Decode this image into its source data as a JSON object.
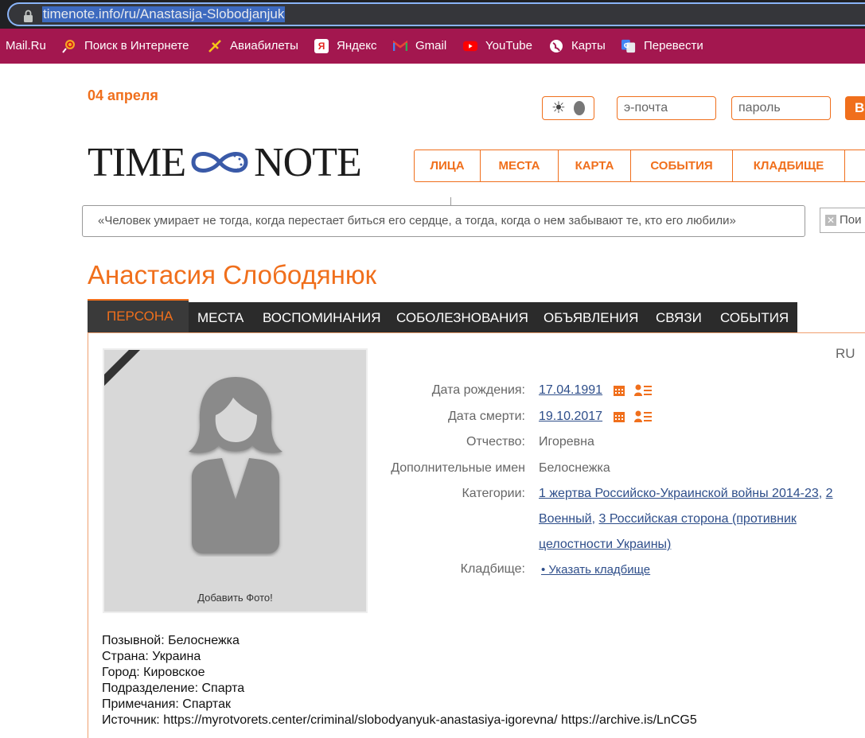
{
  "browser": {
    "url": "timenote.info/ru/Anastasija-Slobodjanjuk"
  },
  "bookmarks": [
    {
      "label": "Mail.Ru",
      "icon": "none"
    },
    {
      "label": "Поиск в Интернете",
      "icon": "lollipop-icon"
    },
    {
      "label": "Авиабилеты",
      "icon": "plane-icon"
    },
    {
      "label": "Яндекс",
      "icon": "yandex-icon"
    },
    {
      "label": "Gmail",
      "icon": "gmail-icon"
    },
    {
      "label": "YouTube",
      "icon": "youtube-icon"
    },
    {
      "label": "Карты",
      "icon": "globe-icon"
    },
    {
      "label": "Перевести",
      "icon": "translate-icon"
    }
  ],
  "header": {
    "date": "04 апреля",
    "email_placeholder": "э-почта",
    "password_placeholder": "пароль",
    "login_label": "В",
    "logo_left": "TIME",
    "logo_right": "NOTE",
    "accent": "#f06f1c"
  },
  "mainnav": [
    "ЛИЦА",
    "МЕСТА",
    "КАРТА",
    "СОБЫТИЯ",
    "КЛАДБИЩЕ",
    ""
  ],
  "quote": "«Человек умирает не тогда, когда перестает биться его сердце, а тогда, когда о нем забывают те, кто его любили»",
  "search_label": "Пои",
  "person": {
    "name": "Анастасия Слободянюк",
    "lang": "RU",
    "photo_caption": "Добавить Фото!"
  },
  "tabs": [
    "ПЕРСОНА",
    "МЕСТА",
    "ВОСПОМИНАНИЯ",
    "СОБОЛЕЗНОВАНИЯ",
    "ОБЪЯВЛЕНИЯ",
    "СВЯЗИ",
    "СОБЫТИЯ"
  ],
  "details": {
    "birth_label": "Дата рождения:",
    "birth_value": "17.04.1991",
    "death_label": "Дата смерти:",
    "death_value": "19.10.2017",
    "patronymic_label": "Отчество:",
    "patronymic_value": "Игоревна",
    "extra_names_label": "Дополнительные имен",
    "extra_names_value": "Белоснежка",
    "categories_label": "Категории:",
    "categories": [
      "1 жертва Российско-Украинской войны 2014-23",
      "2 Военный",
      "3 Российская сторона (противник целостности Украины)"
    ],
    "cemetery_label": "Кладбище:",
    "cemetery_value": "• Указать кладбище"
  },
  "bio": [
    "Позывной: Белоснежка",
    "Страна: Украина",
    "Город: Кировское",
    "Подразделение: Спарта",
    "Примечания: Спартак",
    "Источник: https://myrotvorets.center/criminal/slobodyanyuk-anastasiya-igorevna/ https://archive.is/LnCG5"
  ]
}
